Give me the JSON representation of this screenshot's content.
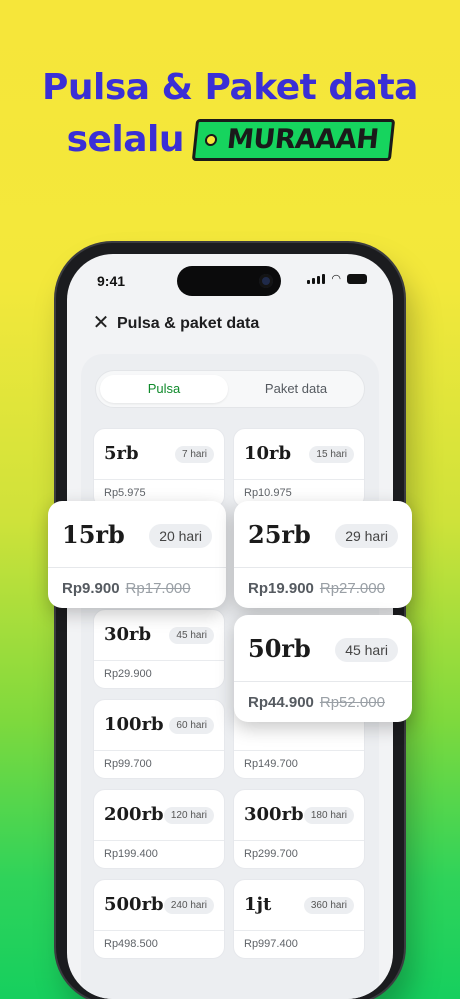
{
  "headline": {
    "line1": "Pulsa & Paket data",
    "line2_prefix": "selalu",
    "tag": "MURAAAH"
  },
  "status_bar": {
    "time": "9:41"
  },
  "nav": {
    "title": "Pulsa & paket data"
  },
  "tabs": [
    {
      "label": "Pulsa",
      "active": true
    },
    {
      "label": "Paket data",
      "active": false
    }
  ],
  "cards": [
    {
      "amount": "5rb",
      "validity": "7 hari",
      "price": "Rp5.975"
    },
    {
      "amount": "10rb",
      "validity": "15 hari",
      "price": "Rp10.975"
    },
    {
      "amount": "30rb",
      "validity": "45 hari",
      "price": "Rp29.900"
    },
    {
      "amount": "100rb",
      "validity": "60 hari",
      "price": "Rp99.700"
    },
    {
      "amount": "",
      "validity": "",
      "price": "Rp149.700"
    },
    {
      "amount": "200rb",
      "validity": "120 hari",
      "price": "Rp199.400"
    },
    {
      "amount": "300rb",
      "validity": "180 hari",
      "price": "Rp299.700"
    },
    {
      "amount": "500rb",
      "validity": "240 hari",
      "price": "Rp498.500"
    },
    {
      "amount": "1jt",
      "validity": "360 hari",
      "price": "Rp997.400"
    }
  ],
  "featured": [
    {
      "amount": "15rb",
      "validity": "20 hari",
      "price": "Rp9.900",
      "old_price": "Rp17.000"
    },
    {
      "amount": "25rb",
      "validity": "29 hari",
      "price": "Rp19.900",
      "old_price": "Rp27.000"
    },
    {
      "amount": "50rb",
      "validity": "45 hari",
      "price": "Rp44.900",
      "old_price": "Rp52.000"
    }
  ],
  "colors": {
    "headline": "#3a2fd6",
    "tag": "#16d45e",
    "active_tab": "#0f8a2b"
  },
  "icons": {
    "close": "close-icon",
    "signal": "signal-icon",
    "wifi": "wifi-icon",
    "battery": "battery-icon"
  }
}
